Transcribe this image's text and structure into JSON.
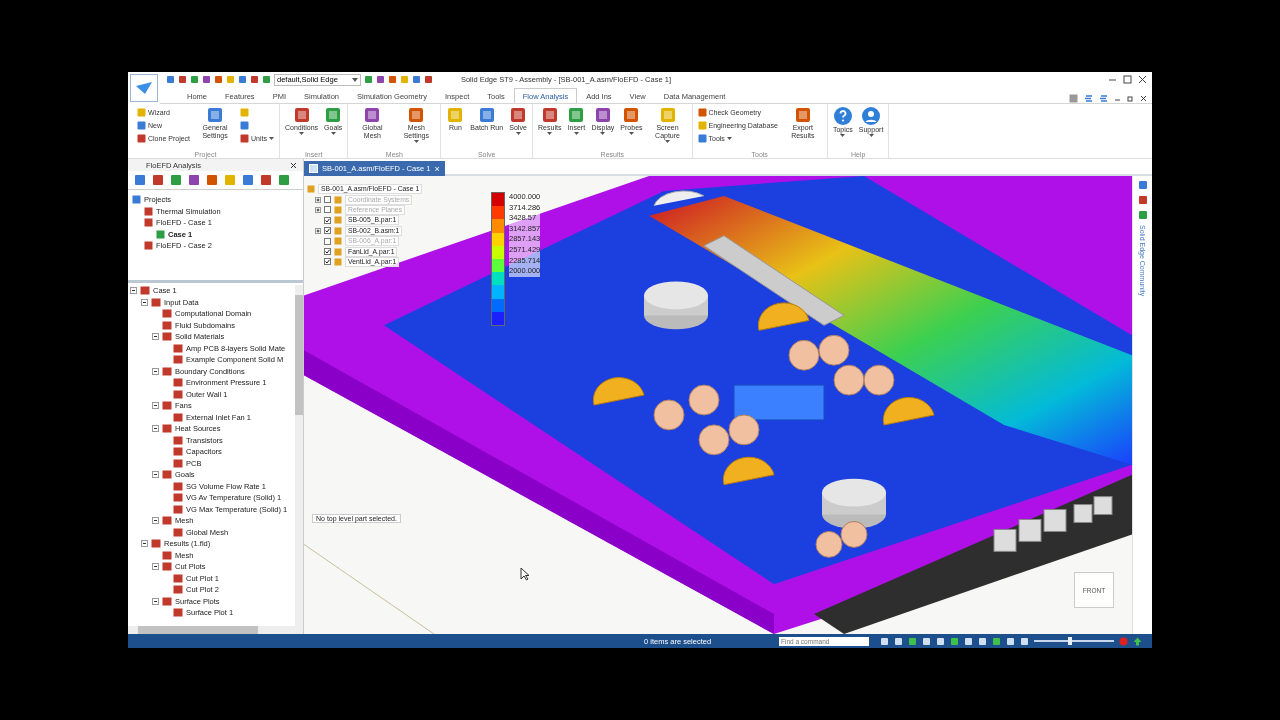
{
  "window": {
    "title": "Solid Edge ST9 - Assembly - [SB-001_A.asm/FloEFD - Case 1]"
  },
  "quick_access": {
    "style_value": "default,Solid Edge"
  },
  "tabs": [
    {
      "label": "Home",
      "selected": false
    },
    {
      "label": "Features",
      "selected": false
    },
    {
      "label": "PMI",
      "selected": false
    },
    {
      "label": "Simulation",
      "selected": false
    },
    {
      "label": "Simulation Geometry",
      "selected": false
    },
    {
      "label": "Inspect",
      "selected": false
    },
    {
      "label": "Tools",
      "selected": false
    },
    {
      "label": "Flow Analysis",
      "selected": true
    },
    {
      "label": "Add Ins",
      "selected": false
    },
    {
      "label": "View",
      "selected": false
    },
    {
      "label": "Data Management",
      "selected": false
    }
  ],
  "ribbon": [
    {
      "label": "Project",
      "items": [
        {
          "kind": "stack",
          "entries": [
            {
              "label": "Wizard",
              "dropdown": false
            },
            {
              "label": "New",
              "dropdown": false
            },
            {
              "label": "Clone Project",
              "dropdown": false
            }
          ]
        },
        {
          "kind": "large",
          "label": "General Settings",
          "dropdown": false
        },
        {
          "kind": "stack",
          "entries": [
            {
              "dropdown": false
            },
            {
              "dropdown": false
            },
            {
              "label": "Units",
              "dropdown": true
            }
          ]
        }
      ]
    },
    {
      "label": "Insert",
      "items": [
        {
          "kind": "large",
          "label": "Conditions",
          "dropdown": true
        },
        {
          "kind": "large",
          "label": "Goals",
          "dropdown": true
        }
      ]
    },
    {
      "label": "Mesh",
      "items": [
        {
          "kind": "large",
          "label": "Global Mesh",
          "dropdown": false
        },
        {
          "kind": "large",
          "label": "Mesh Settings",
          "dropdown": true
        }
      ]
    },
    {
      "label": "Solve",
      "items": [
        {
          "kind": "large",
          "label": "Run",
          "dropdown": false
        },
        {
          "kind": "large",
          "label": "Batch Run",
          "dropdown": false
        },
        {
          "kind": "large",
          "label": "Solve",
          "dropdown": true
        }
      ]
    },
    {
      "label": "Results",
      "items": [
        {
          "kind": "large",
          "label": "Results",
          "dropdown": true
        },
        {
          "kind": "large",
          "label": "Insert",
          "dropdown": true
        },
        {
          "kind": "large",
          "label": "Display",
          "dropdown": true
        },
        {
          "kind": "large",
          "label": "Probes",
          "dropdown": true
        },
        {
          "kind": "large",
          "label": "Screen Capture",
          "dropdown": true
        }
      ]
    },
    {
      "label": "Tools",
      "items": [
        {
          "kind": "stack",
          "entries": [
            {
              "label": "Check Geometry",
              "dropdown": false
            },
            {
              "label": "Engineering Database",
              "dropdown": false
            },
            {
              "label": "Tools",
              "dropdown": true
            }
          ]
        },
        {
          "kind": "large",
          "label": "Export Results",
          "dropdown": false
        }
      ]
    },
    {
      "label": "Help",
      "items": [
        {
          "kind": "help",
          "label": "Topics",
          "dropdown": true
        },
        {
          "kind": "user",
          "label": "Support",
          "dropdown": true
        }
      ]
    }
  ],
  "analysis_panel": {
    "title": "FloEFD Analysis",
    "projects": [
      {
        "label": "Projects",
        "selected": false,
        "children": [
          {
            "label": "Thermal Simulation",
            "selected": false
          },
          {
            "label": "FloEFD - Case 1",
            "selected": false,
            "children": [
              {
                "label": "Case 1",
                "selected": true
              }
            ]
          },
          {
            "label": "FloEFD - Case 2",
            "selected": false
          }
        ]
      }
    ],
    "case_tree": [
      {
        "label": "Case 1",
        "children": [
          {
            "label": "Input Data",
            "children": [
              {
                "label": "Computational Domain"
              },
              {
                "label": "Fluid Subdomains"
              },
              {
                "label": "Solid Materials",
                "children": [
                  {
                    "label": "Amp PCB 8-layers Solid Mate"
                  },
                  {
                    "label": "Example Component Solid M"
                  }
                ]
              },
              {
                "label": "Boundary Conditions",
                "children": [
                  {
                    "label": "Environment Pressure 1"
                  },
                  {
                    "label": "Outer Wall 1"
                  }
                ]
              },
              {
                "label": "Fans",
                "children": [
                  {
                    "label": "External Inlet Fan 1"
                  }
                ]
              },
              {
                "label": "Heat Sources",
                "children": [
                  {
                    "label": "Transistors"
                  },
                  {
                    "label": "Capacitors"
                  },
                  {
                    "label": "PCB"
                  }
                ]
              },
              {
                "label": "Goals",
                "children": [
                  {
                    "label": "SG Volume Flow Rate 1"
                  },
                  {
                    "label": "VG Av Temperature (Solid) 1"
                  },
                  {
                    "label": "VG Max Temperature (Solid) 1"
                  }
                ]
              },
              {
                "label": "Mesh",
                "children": [
                  {
                    "label": "Global Mesh"
                  }
                ]
              }
            ]
          },
          {
            "label": "Results (1.fld)",
            "children": [
              {
                "label": "Mesh"
              },
              {
                "label": "Cut Plots",
                "children": [
                  {
                    "label": "Cut Plot 1"
                  },
                  {
                    "label": "Cut Plot 2"
                  }
                ]
              },
              {
                "label": "Surface Plots",
                "children": [
                  {
                    "label": "Surface Plot 1"
                  }
                ]
              }
            ]
          }
        ]
      }
    ]
  },
  "document_tab": {
    "label": "SB-001_A.asm/FloEFD - Case 1",
    "close": "×"
  },
  "assembly_tree": {
    "root": "SB-001_A.asm/FloEFD - Case 1",
    "items": [
      {
        "label": "Coordinate Systems",
        "checked": false,
        "expandable": true
      },
      {
        "label": "Reference Planes",
        "checked": false,
        "expandable": true
      },
      {
        "label": "SB-005_B.par:1",
        "checked": true,
        "expandable": false
      },
      {
        "label": "SB-002_B.asm:1",
        "checked": true,
        "expandable": true
      },
      {
        "label": "SB-006_A.par:1",
        "checked": false,
        "expandable": false
      },
      {
        "label": "FanLid_A.par:1",
        "checked": true,
        "expandable": false
      },
      {
        "label": "VentLid_A.par:1",
        "checked": true,
        "expandable": false
      }
    ]
  },
  "legend": {
    "labels": [
      "4000.000",
      "3714.286",
      "3428.57",
      "3142.857",
      "2857.143",
      "2571.429",
      "2285.714",
      "2000.000"
    ]
  },
  "viewport_message": "No top level part selected.",
  "view_cube": {
    "label": "FRONT"
  },
  "side_dock": {
    "label": "Solid Edge Community"
  },
  "status_bar": {
    "message": "0 items are selected",
    "command_placeholder": "Find a command",
    "zoom_slider": {
      "level": 0.45
    }
  }
}
